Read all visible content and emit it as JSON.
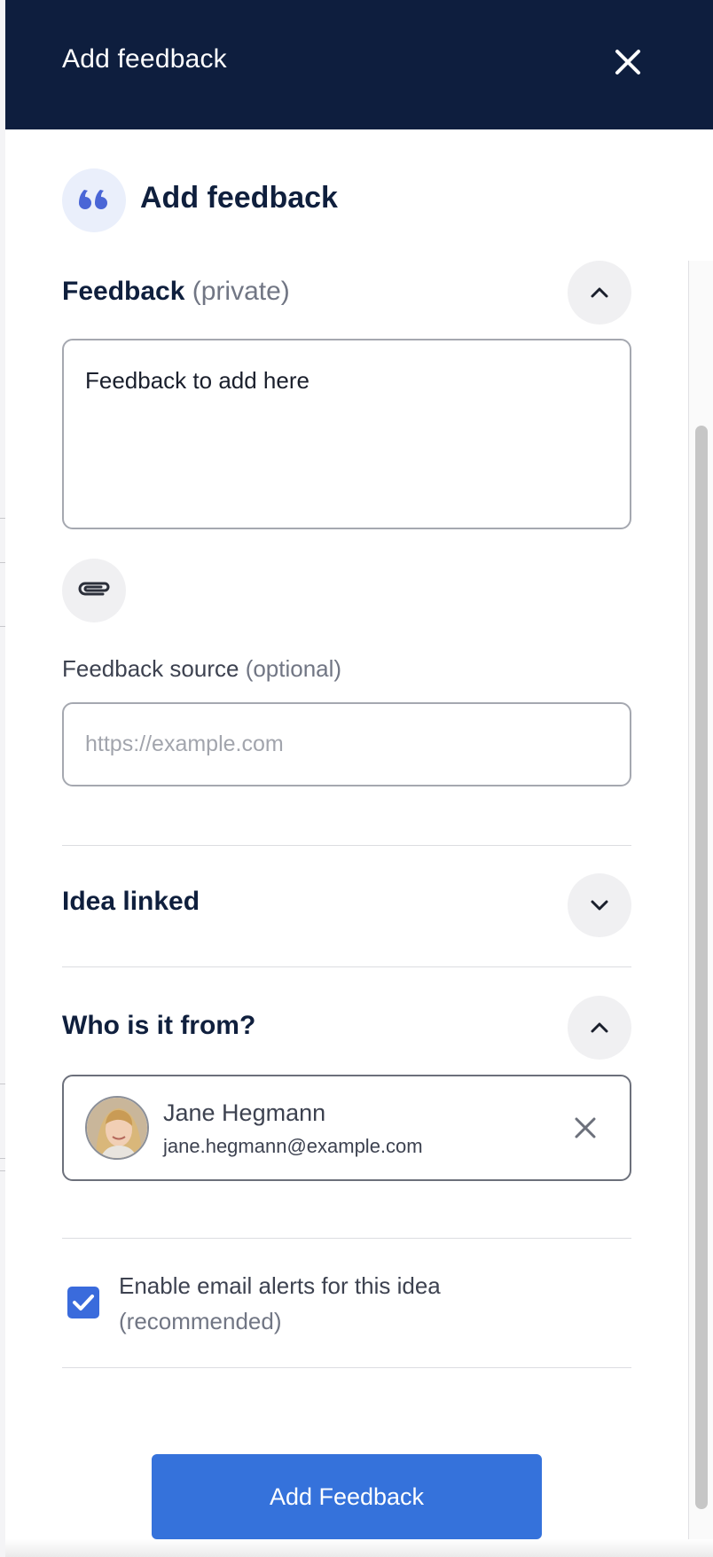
{
  "header": {
    "title": "Add feedback"
  },
  "section": {
    "title": "Add feedback"
  },
  "feedback": {
    "label": "Feedback",
    "qualifier": "(private)",
    "value": "Feedback to add here"
  },
  "source": {
    "label": "Feedback source",
    "qualifier": "(optional)",
    "placeholder": "https://example.com"
  },
  "idea_linked": {
    "label": "Idea linked"
  },
  "from": {
    "label": "Who is it from?",
    "person": {
      "name": "Jane Hegmann",
      "email": "jane.hegmann@example.com"
    }
  },
  "alerts": {
    "label": "Enable email alerts for this idea",
    "qualifier": "(recommended)",
    "checked": true
  },
  "submit": {
    "label": "Add Feedback"
  },
  "colors": {
    "header_bg": "#0e1e3e",
    "accent": "#3572db",
    "quote_icon": "#4a66d6"
  },
  "icons": [
    "close-icon",
    "quote-icon",
    "chevron-up-icon",
    "chevron-down-icon",
    "paperclip-icon",
    "check-icon"
  ]
}
